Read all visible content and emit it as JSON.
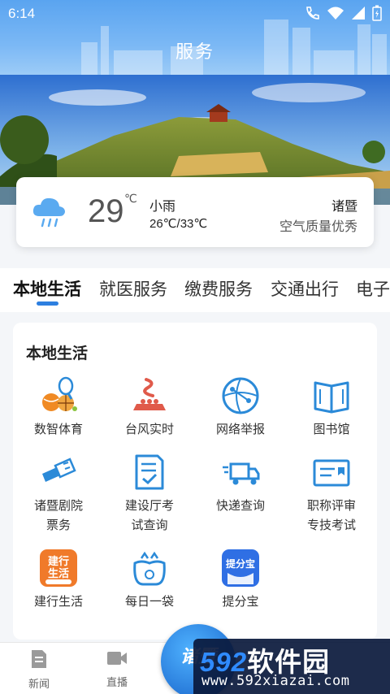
{
  "status_bar": {
    "time": "6:14"
  },
  "header": {
    "title": "服务"
  },
  "weather": {
    "temperature": "29",
    "unit": "℃",
    "condition": "小雨",
    "range": "26℃/33℃",
    "city": "诸暨",
    "air_quality": "空气质量优秀"
  },
  "tabs": [
    "本地生活",
    "就医服务",
    "缴费服务",
    "交通出行",
    "电子"
  ],
  "active_tab": 0,
  "section": {
    "title": "本地生活",
    "services": [
      {
        "label": "数智体育",
        "icon": "sports-balls-icon"
      },
      {
        "label": "台风实时",
        "icon": "typhoon-icon"
      },
      {
        "label": "网络举报",
        "icon": "network-globe-icon"
      },
      {
        "label": "图书馆",
        "icon": "open-book-icon"
      },
      {
        "label": "诸暨剧院票务",
        "icon": "tickets-icon"
      },
      {
        "label": "建设厅考试查询",
        "icon": "exam-document-icon"
      },
      {
        "label": "快递查询",
        "icon": "delivery-truck-icon"
      },
      {
        "label": "职称评审专技考试",
        "icon": "id-card-icon"
      },
      {
        "label": "建行生活",
        "icon": "ccb-life-app-icon"
      },
      {
        "label": "每日一袋",
        "icon": "garbage-bags-icon"
      },
      {
        "label": "提分宝",
        "icon": "tifenbao-app-icon"
      }
    ]
  },
  "bottom_nav": [
    {
      "label": "新闻",
      "icon": "news-document-icon"
    },
    {
      "label": "直播",
      "icon": "video-camera-icon"
    }
  ],
  "center_badge": {
    "text": "诸暨"
  },
  "watermark": {
    "brand_num": "592",
    "brand_cn": "软件园",
    "url": "www.592xiazai.com"
  },
  "colors": {
    "header": "#5aa4f0",
    "accent": "#2d7fe0",
    "icon_orange": "#f08a24",
    "icon_blue": "#2b8ad8"
  }
}
